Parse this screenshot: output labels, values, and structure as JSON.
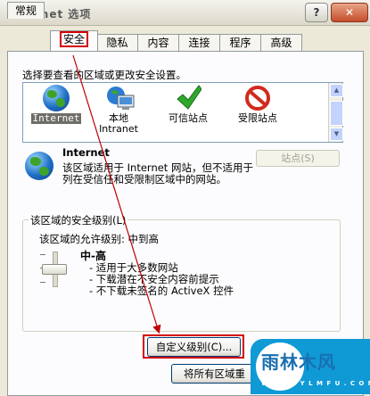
{
  "window": {
    "title": "Internet 选项",
    "help_label": "?",
    "close_label": "✕"
  },
  "tabs": [
    "常规",
    "安全",
    "隐私",
    "内容",
    "连接",
    "程序",
    "高级"
  ],
  "active_tab": "安全",
  "instruction": "选择要查看的区域或更改安全设置。",
  "zones": [
    {
      "label": "Internet",
      "icon": "globe-icon",
      "selected": true
    },
    {
      "label": "本地\nIntranet",
      "icon": "intranet-icon",
      "selected": false
    },
    {
      "label": "可信站点",
      "icon": "checkmark-icon",
      "selected": false
    },
    {
      "label": "受限站点",
      "icon": "prohibited-icon",
      "selected": false
    }
  ],
  "zone_detail": {
    "title": "Internet",
    "description": "该区域适用于 Internet 网站，但不适用于列在受信任和受限制区域中的网站。",
    "sites_button": "站点(S)"
  },
  "security_level": {
    "group_title": "该区域的安全级别(L)",
    "allowed_levels": "该区域的允许级别: 中到高",
    "level_name": "中-高",
    "bullets": [
      "- 适用于大多数网站",
      "- 下载潜在不安全内容前提示",
      "- 不下载未签名的 ActiveX 控件"
    ],
    "slider_level": "中-高"
  },
  "buttons": {
    "custom_level": "自定义级别(C)...",
    "reset_all": "将所有区域重"
  },
  "watermark": {
    "text": "雨林木风",
    "url": "W W W . Y L M F U . C O M"
  },
  "colors": {
    "highlight_red": "#d40000",
    "panel_bg": "#fcfcfe",
    "dialog_bg": "#ece9d8",
    "watermark_blue": "#0f9ad6"
  }
}
